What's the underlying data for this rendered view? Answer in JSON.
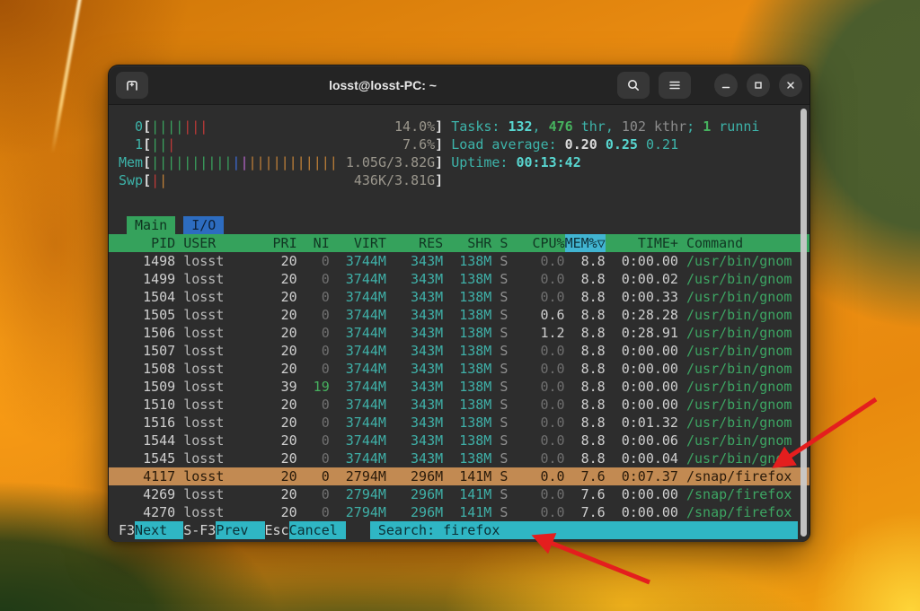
{
  "window": {
    "title": "losst@losst-PC: ~",
    "titlebar": {
      "new_tab_icon": "new-tab-icon",
      "search_icon": "search-icon",
      "menu_icon": "hamburger-menu-icon",
      "minimize_icon": "minimize-icon",
      "maximize_icon": "maximize-icon",
      "close_icon": "close-icon"
    }
  },
  "colors": {
    "terminal_bg": "#2d2d2d",
    "header_green": "#35a25c",
    "tab_blue": "#2d6cc0",
    "sort_cell_cyan": "#41b4d1",
    "highlight_tan": "#c28a52",
    "fnbar_cyan": "#2fb6c4",
    "value_cyan": "#3fb0a8",
    "command_green": "#3da563",
    "arrow_red": "#e41e1e"
  },
  "htop": {
    "bar_colors": {
      "green": "#3aa35f",
      "red": "#c03a38",
      "blue": "#3d6bd8",
      "magenta": "#b565c9",
      "orange": "#c08038"
    },
    "meters": [
      {
        "label": "0",
        "bars": [
          [
            "green",
            4
          ],
          [
            "red",
            3
          ]
        ],
        "value": "14.0%"
      },
      {
        "label": "1",
        "bars": [
          [
            "green",
            2
          ],
          [
            "red",
            1
          ]
        ],
        "value": "7.6%"
      },
      {
        "label": "Mem",
        "bars": [
          [
            "green",
            10
          ],
          [
            "blue",
            1
          ],
          [
            "magenta",
            1
          ],
          [
            "orange",
            11
          ]
        ],
        "value": "1.05G/3.82G"
      },
      {
        "label": "Swp",
        "bars": [
          [
            "red",
            1
          ],
          [
            "orange",
            1
          ]
        ],
        "value": "436K/3.81G"
      }
    ],
    "info": [
      [
        {
          "t": "Tasks: ",
          "c": "cyan"
        },
        {
          "t": "132",
          "c": "cyanb"
        },
        {
          "t": ", ",
          "c": "cyan"
        },
        {
          "t": "476",
          "c": "greenb"
        },
        {
          "t": " thr",
          "c": "cyan"
        },
        {
          "t": ", ",
          "c": "cyan"
        },
        {
          "t": "102",
          "c": "grayc"
        },
        {
          "t": " kthr",
          "c": "grayc"
        },
        {
          "t": "; ",
          "c": "cyan"
        },
        {
          "t": "1",
          "c": "greenb"
        },
        {
          "t": " runni",
          "c": "cyan"
        }
      ],
      [
        {
          "t": "Load average: ",
          "c": "cyan"
        },
        {
          "t": "0.20 ",
          "c": "whiteb"
        },
        {
          "t": "0.25 ",
          "c": "cyanb"
        },
        {
          "t": "0.21",
          "c": "cyan"
        }
      ],
      [
        {
          "t": "Uptime: ",
          "c": "cyan"
        },
        {
          "t": "00:13:42",
          "c": "cyanb"
        }
      ]
    ],
    "tabs": [
      {
        "label": "Main",
        "active": true
      },
      {
        "label": "I/O",
        "active": false
      }
    ],
    "columns": [
      "PID",
      "USER",
      "PRI",
      "NI",
      "VIRT",
      "RES",
      "SHR",
      "S",
      "CPU%",
      "MEM%▽",
      "TIME+",
      "Command"
    ],
    "sort_column": "MEM%▽",
    "rows": [
      {
        "cells": [
          "1498",
          "losst",
          "20",
          "0",
          "3744M",
          "343M",
          "138M",
          "S",
          "0.0",
          "8.8",
          "0:00.00",
          "/usr/bin/gnom"
        ],
        "hl": false
      },
      {
        "cells": [
          "1499",
          "losst",
          "20",
          "0",
          "3744M",
          "343M",
          "138M",
          "S",
          "0.0",
          "8.8",
          "0:00.02",
          "/usr/bin/gnom"
        ],
        "hl": false
      },
      {
        "cells": [
          "1504",
          "losst",
          "20",
          "0",
          "3744M",
          "343M",
          "138M",
          "S",
          "0.0",
          "8.8",
          "0:00.33",
          "/usr/bin/gnom"
        ],
        "hl": false
      },
      {
        "cells": [
          "1505",
          "losst",
          "20",
          "0",
          "3744M",
          "343M",
          "138M",
          "S",
          "0.6",
          "8.8",
          "0:28.28",
          "/usr/bin/gnom"
        ],
        "hl": false
      },
      {
        "cells": [
          "1506",
          "losst",
          "20",
          "0",
          "3744M",
          "343M",
          "138M",
          "S",
          "1.2",
          "8.8",
          "0:28.91",
          "/usr/bin/gnom"
        ],
        "hl": false
      },
      {
        "cells": [
          "1507",
          "losst",
          "20",
          "0",
          "3744M",
          "343M",
          "138M",
          "S",
          "0.0",
          "8.8",
          "0:00.00",
          "/usr/bin/gnom"
        ],
        "hl": false
      },
      {
        "cells": [
          "1508",
          "losst",
          "20",
          "0",
          "3744M",
          "343M",
          "138M",
          "S",
          "0.0",
          "8.8",
          "0:00.00",
          "/usr/bin/gnom"
        ],
        "hl": false
      },
      {
        "cells": [
          "1509",
          "losst",
          "39",
          "19",
          "3744M",
          "343M",
          "138M",
          "S",
          "0.0",
          "8.8",
          "0:00.00",
          "/usr/bin/gnom"
        ],
        "hl": false
      },
      {
        "cells": [
          "1510",
          "losst",
          "20",
          "0",
          "3744M",
          "343M",
          "138M",
          "S",
          "0.0",
          "8.8",
          "0:00.00",
          "/usr/bin/gnom"
        ],
        "hl": false
      },
      {
        "cells": [
          "1516",
          "losst",
          "20",
          "0",
          "3744M",
          "343M",
          "138M",
          "S",
          "0.0",
          "8.8",
          "0:01.32",
          "/usr/bin/gnom"
        ],
        "hl": false
      },
      {
        "cells": [
          "1544",
          "losst",
          "20",
          "0",
          "3744M",
          "343M",
          "138M",
          "S",
          "0.0",
          "8.8",
          "0:00.06",
          "/usr/bin/gnom"
        ],
        "hl": false
      },
      {
        "cells": [
          "1545",
          "losst",
          "20",
          "0",
          "3744M",
          "343M",
          "138M",
          "S",
          "0.0",
          "8.8",
          "0:00.04",
          "/usr/bin/gnom"
        ],
        "hl": false
      },
      {
        "cells": [
          "4117",
          "losst",
          "20",
          "0",
          "2794M",
          "296M",
          "141M",
          "S",
          "0.0",
          "7.6",
          "0:07.37",
          "/snap/firefox"
        ],
        "hl": true
      },
      {
        "cells": [
          "4269",
          "losst",
          "20",
          "0",
          "2794M",
          "296M",
          "141M",
          "S",
          "0.0",
          "7.6",
          "0:00.00",
          "/snap/firefox"
        ],
        "hl": false
      },
      {
        "cells": [
          "4270",
          "losst",
          "20",
          "0",
          "2794M",
          "296M",
          "141M",
          "S",
          "0.0",
          "7.6",
          "0:00.00",
          "/snap/firefox"
        ],
        "hl": false
      }
    ],
    "fnbar": {
      "keys": [
        {
          "key": "F3",
          "label": "Next  "
        },
        {
          "key": "S-F3",
          "label": "Prev  "
        },
        {
          "key": "Esc",
          "label": "Cancel "
        }
      ],
      "search": " Search: firefox"
    }
  },
  "annotations": {
    "arrow_to_process_row": "points at highlighted firefox process row",
    "arrow_to_search_bar": "points at search input in function bar"
  }
}
